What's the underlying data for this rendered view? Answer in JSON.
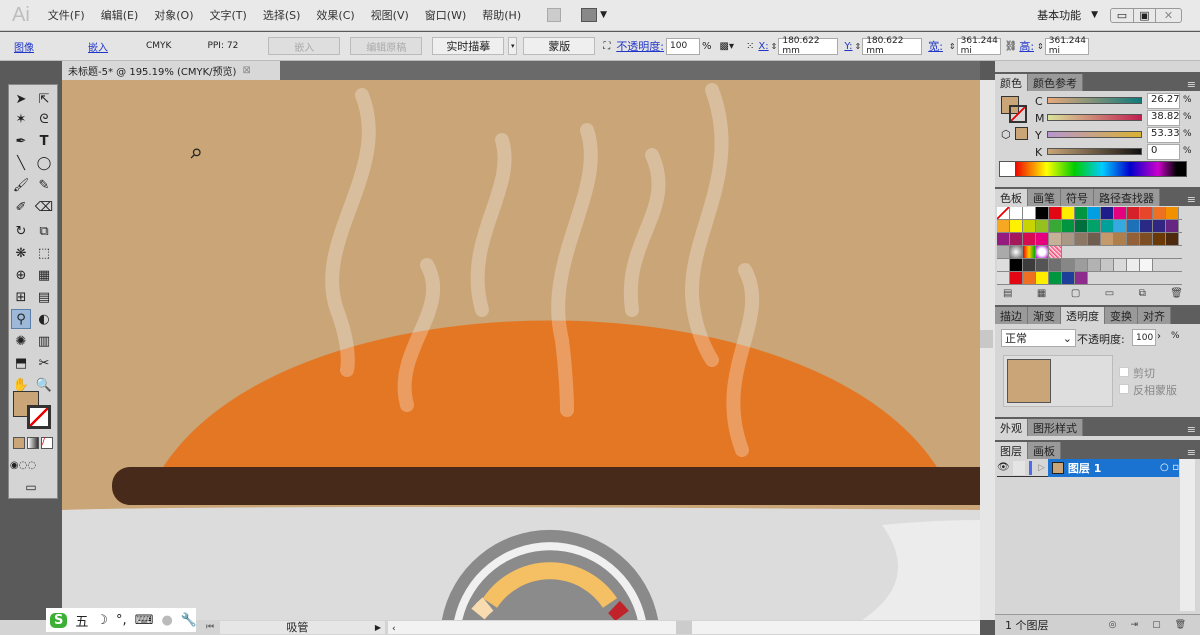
{
  "app": {
    "logo": "Ai",
    "workspace": "基本功能"
  },
  "menu": [
    "文件(F)",
    "编辑(E)",
    "对象(O)",
    "文字(T)",
    "选择(S)",
    "效果(C)",
    "视图(V)",
    "窗口(W)",
    "帮助(H)"
  ],
  "control": {
    "image_link": "图像",
    "embed_link": "嵌入",
    "color_mode": "CMYK",
    "ppi": "PPI: 72",
    "embed_btn": "嵌入",
    "edit_original_btn": "编辑原稿",
    "live_trace_btn": "实时描摹",
    "mask_btn": "蒙版",
    "opacity_label": "不透明度:",
    "opacity_value": "100",
    "percent": "%",
    "x_label": "X:",
    "x_value": "180.622 mm",
    "y_label": "Y:",
    "y_value": "180.622 mm",
    "w_label": "宽:",
    "w_value": "361.244 mi",
    "h_label": "高:",
    "h_value": "361.244 mi"
  },
  "document_tab": {
    "title": "未标题-5* @ 195.19% (CMYK/预览)"
  },
  "color_panel": {
    "tabs": [
      "颜色",
      "颜色参考"
    ],
    "channels": [
      {
        "label": "C",
        "value": "26.27",
        "pct": 26.27
      },
      {
        "label": "M",
        "value": "38.82",
        "pct": 38.82
      },
      {
        "label": "Y",
        "value": "53.33",
        "pct": 53.33
      },
      {
        "label": "K",
        "value": "0",
        "pct": 0
      }
    ],
    "percent": "%",
    "fill_color": "#c9a577"
  },
  "swatch_panel": {
    "tabs": [
      "色板",
      "画笔",
      "符号",
      "路径查找器"
    ],
    "rows": [
      [
        "#ffffff",
        "#000000",
        "#e30613",
        "#ffed00",
        "#009640",
        "#009fe3",
        "#1d1d8b",
        "#e5007d",
        "#d6202a",
        "#e8462a",
        "#ee7023",
        "#f29100"
      ],
      [
        "#f7a823",
        "#fff100",
        "#c8d400",
        "#95c11f",
        "#39a935",
        "#009640",
        "#006f3d",
        "#00a26a",
        "#00a19a",
        "#36a9e1",
        "#1d71b8",
        "#2a2a86",
        "#312783",
        "#662483"
      ],
      [
        "#951b81",
        "#a3195b",
        "#d60b52",
        "#e6007e",
        "#c6b198",
        "#a99886",
        "#8c7765",
        "#6f5e4f",
        "#c49a6c",
        "#ae7f4a",
        "#946037",
        "#7d4e24",
        "#6a3906",
        "#4e2b0c"
      ]
    ],
    "grays": [
      "#000000",
      "#3c3c3c",
      "#555555",
      "#707070",
      "#878787",
      "#9d9d9d",
      "#b2b2b2",
      "#c6c6c6",
      "#dadada",
      "#ededed",
      "#f6f6f6"
    ],
    "brights": [
      "#e30613",
      "#ee7023",
      "#ffed00",
      "#009640",
      "#1d3f9a",
      "#8e2c8e"
    ]
  },
  "transparency_panel": {
    "tabs": [
      "描边",
      "渐变",
      "透明度",
      "变换",
      "对齐"
    ],
    "blend_mode": "正常",
    "opacity_label": "不透明度:",
    "opacity_value": "100",
    "percent": "%",
    "clip_label": "剪切",
    "invert_label": "反相蒙版"
  },
  "appearance_panel": {
    "tabs": [
      "外观",
      "图形样式"
    ]
  },
  "layers_panel": {
    "tabs": [
      "图层",
      "画板"
    ],
    "layers": [
      {
        "name": "图层 1"
      }
    ],
    "count": "1 个图层"
  },
  "status": {
    "tool_name": "吸管"
  },
  "ime": {
    "items": [
      "五"
    ]
  }
}
